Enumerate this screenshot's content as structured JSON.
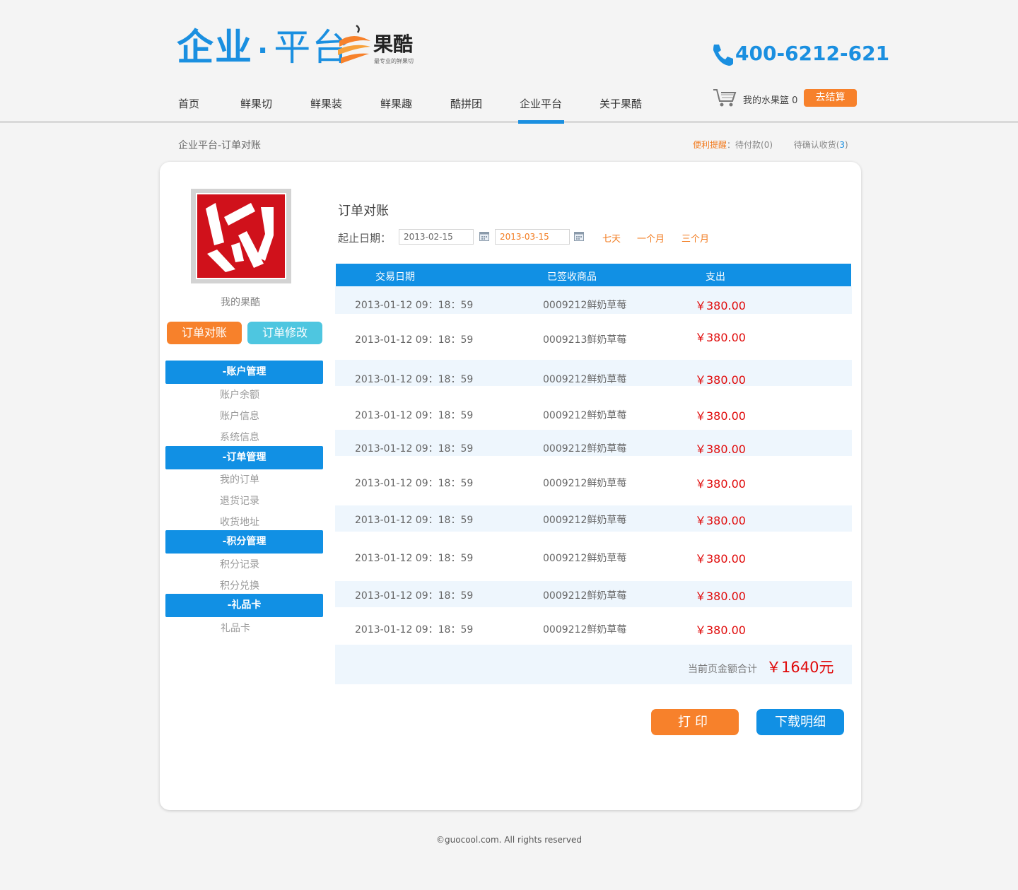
{
  "header": {
    "brand_part1": "企业",
    "brand_dot": "·",
    "brand_part2": "平台",
    "logo_text": "果酷",
    "logo_subtitle": "最专业的鲜果切",
    "phone": "400-6212-621"
  },
  "nav": {
    "items": [
      {
        "label": "首页"
      },
      {
        "label": "鲜果切"
      },
      {
        "label": "鲜果装"
      },
      {
        "label": "鲜果趣"
      },
      {
        "label": "酷拼团"
      },
      {
        "label": "企业平台",
        "active": true
      },
      {
        "label": "关于果酷"
      }
    ],
    "cart_label": "我的水果篮",
    "cart_count": "0",
    "checkout_label": "去结算"
  },
  "breadcrumb": "企业平台-订单对账",
  "reminder": {
    "label": "便利提醒",
    "colon": "：",
    "pending_payment": "待付款(0)",
    "pending_receipt_prefix": "待确认收货(",
    "pending_receipt_count": "3",
    "pending_receipt_suffix": ")"
  },
  "sidebar": {
    "user_name": "我的果酷",
    "btn_reconcile": "订单对账",
    "btn_modify": "订单修改",
    "sections": [
      {
        "title": "-账户管理",
        "items": [
          "账户余额",
          "账户信息",
          "系统信息"
        ]
      },
      {
        "title": "-订单管理",
        "items": [
          "我的订单",
          "退货记录",
          "收货地址"
        ]
      },
      {
        "title": "-积分管理",
        "items": [
          "积分记录",
          "积分兑换"
        ]
      },
      {
        "title": "-礼品卡",
        "items": [
          "礼品卡"
        ]
      }
    ]
  },
  "main": {
    "title": "订单对账",
    "date_label": "起止日期：",
    "start_date": "2013-02-15",
    "end_date": "2013-03-15",
    "ranges": [
      "七天",
      "一个月",
      "三个月"
    ],
    "columns": [
      "交易日期",
      "已签收商品",
      "支出"
    ],
    "rows": [
      {
        "date": "2013-01-12  09：18：59",
        "product": "0009212鲜奶草莓",
        "amount": "￥380.00"
      },
      {
        "date": "2013-01-12  09：18：59",
        "product": "0009213鲜奶草莓",
        "amount": "￥380.00"
      },
      {
        "date": "2013-01-12  09：18：59",
        "product": "0009212鲜奶草莓",
        "amount": "￥380.00"
      },
      {
        "date": "2013-01-12  09：18：59",
        "product": "0009212鲜奶草莓",
        "amount": "￥380.00"
      },
      {
        "date": "2013-01-12  09：18：59",
        "product": "0009212鲜奶草莓",
        "amount": "￥380.00"
      },
      {
        "date": "2013-01-12  09：18：59",
        "product": "0009212鲜奶草莓",
        "amount": "￥380.00"
      },
      {
        "date": "2013-01-12  09：18：59",
        "product": "0009212鲜奶草莓",
        "amount": "￥380.00"
      },
      {
        "date": "2013-01-12  09：18：59",
        "product": "0009212鲜奶草莓",
        "amount": "￥380.00"
      },
      {
        "date": "2013-01-12  09：18：59",
        "product": "0009212鲜奶草莓",
        "amount": "￥380.00"
      },
      {
        "date": "2013-01-12  09：18：59",
        "product": "0009212鲜奶草莓",
        "amount": "￥380.00"
      }
    ],
    "total_label": "当前页金额合计",
    "total_value": "￥1640元",
    "print_label": "打印",
    "download_label": "下载明细"
  },
  "footer": "©guocool.com. All rights reserved",
  "colors": {
    "brand_blue": "#1a8fe0",
    "accent_orange": "#f7812b",
    "amount_red": "#e00a0a",
    "cyan": "#4ec6e0"
  }
}
